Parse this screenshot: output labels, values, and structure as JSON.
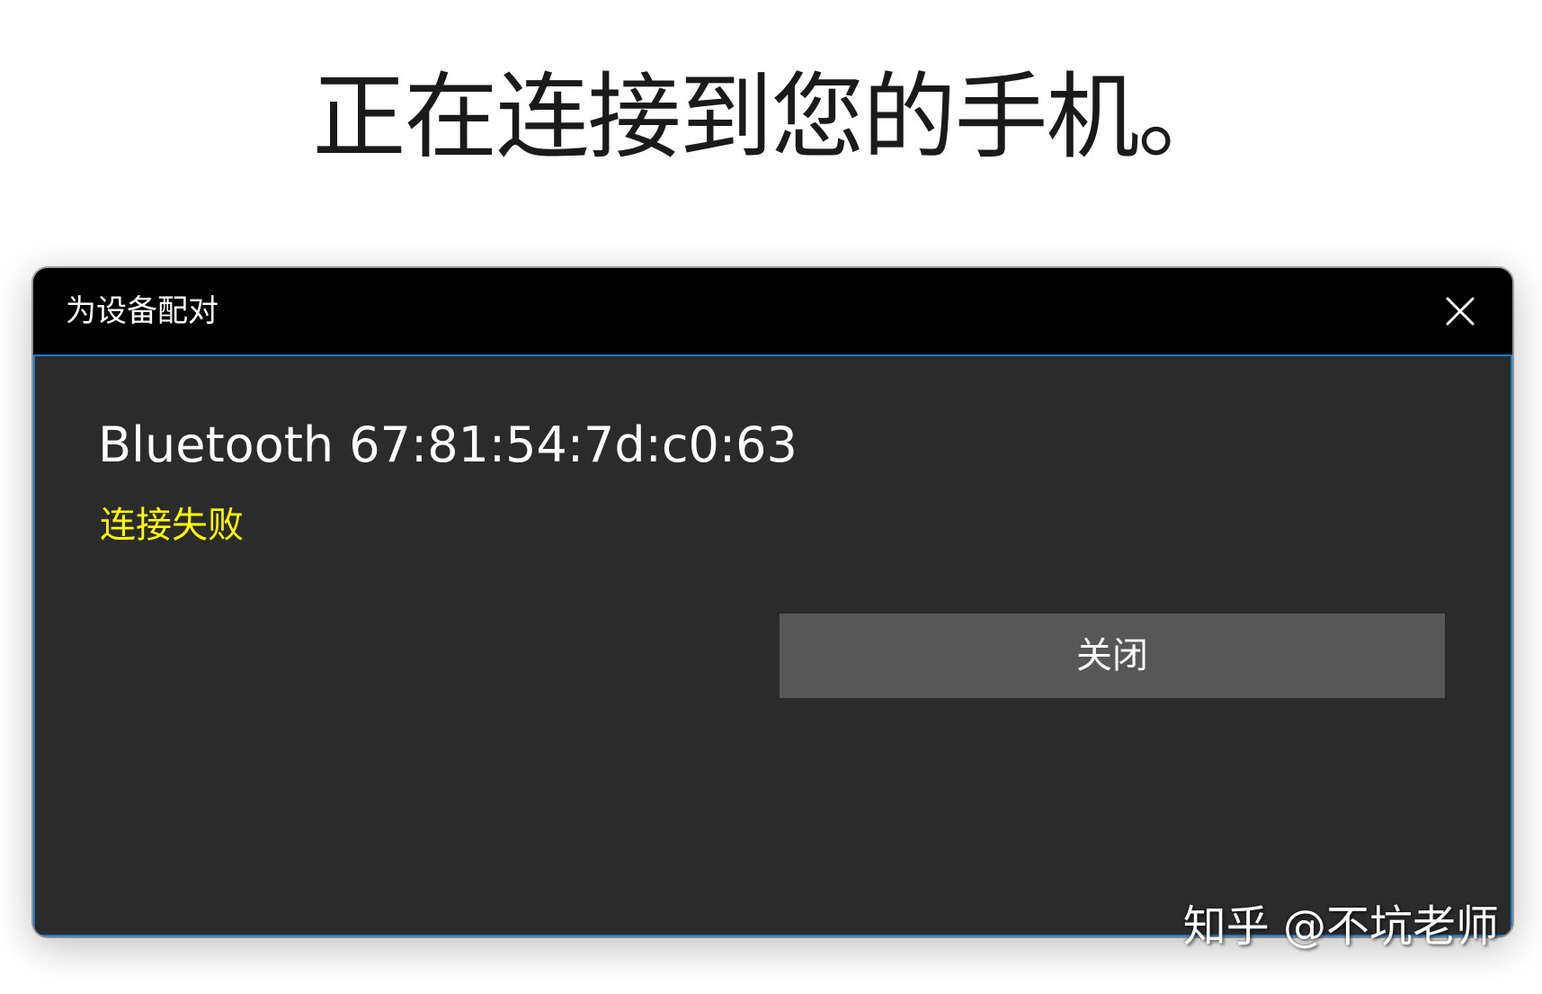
{
  "page": {
    "title": "正在连接到您的手机。"
  },
  "dialog": {
    "title": "为设备配对",
    "close_icon": "close-icon",
    "device_name": "Bluetooth 67:81:54:7d:c0:63",
    "status": "连接失败",
    "close_button_label": "关闭"
  },
  "watermark": {
    "text": "知乎 @不坑老师"
  },
  "colors": {
    "page_background": "#ffffff",
    "titlebar": "#000000",
    "dialog_background": "#2b2b2b",
    "accent_border": "#1f78c8",
    "status_text": "#ffff00",
    "button_background": "#575757"
  }
}
